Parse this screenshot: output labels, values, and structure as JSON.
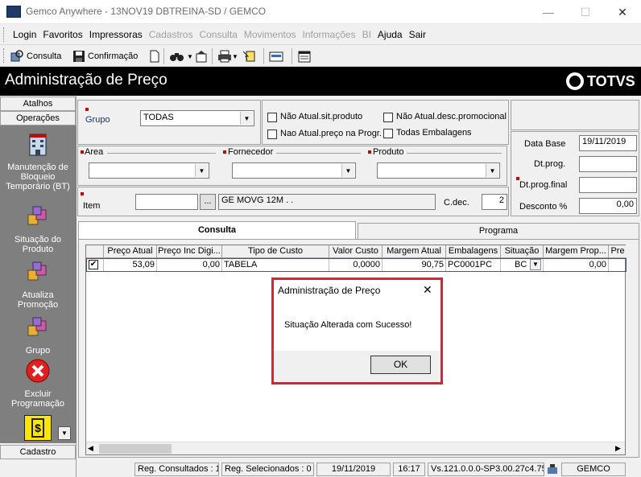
{
  "window": {
    "title": "Gemco Anywhere - 13NOV19 DBTREINA-SD / GEMCO",
    "minimize": "—",
    "maximize": "☐",
    "close": "✕"
  },
  "menu": [
    "Login",
    "Favoritos",
    "Impressoras",
    "Cadastros",
    "Consulta",
    "Movimentos",
    "Informações",
    "BI",
    "Ajuda",
    "Sair"
  ],
  "menu_disabled": [
    false,
    false,
    false,
    true,
    true,
    true,
    true,
    true,
    false,
    false
  ],
  "toolbar": {
    "consulta": "Consulta",
    "confirmacao": "Confirmação"
  },
  "header": {
    "title": "Administração de Preço",
    "logo": "TOTVS"
  },
  "sidebar": {
    "tab_atalhos": "Atalhos",
    "tab_operacoes": "Operações",
    "tab_cadastro": "Cadastro",
    "items": [
      {
        "label": "Manutenção de Bloqueio Temporário (BT)",
        "icon": "building-icon"
      },
      {
        "label": "Situação do Produto",
        "icon": "cubes-icon"
      },
      {
        "label": "Atualiza Promoção",
        "icon": "cubes-icon"
      },
      {
        "label": "Grupo",
        "icon": "cubes-icon"
      },
      {
        "label": "Excluir Programação",
        "icon": "delete-icon"
      }
    ]
  },
  "filters": {
    "grupo_label": "Grupo",
    "grupo_value": "TODAS",
    "chk_nao_atual_sit": "Não Atual.sit.produto",
    "chk_nao_atual_desc": "Não Atual.desc.promocional",
    "chk_nao_atual_preco": "Nao Atual.preço na Progr.",
    "chk_todas_emb": "Todas Embalagens",
    "area_label": "Area",
    "fornecedor_label": "Fornecedor",
    "produto_label": "Produto",
    "item_label": "Item",
    "item_value": "",
    "item_btn": "...",
    "item_desc": "GE MOVG 12M  . .",
    "cdec_label": "C.dec.",
    "cdec_value": "2",
    "data_base_label": "Data Base",
    "data_base_value": "19/11/2019",
    "dt_prog_label": "Dt.prog.",
    "dt_prog_value": "",
    "dt_prog_final_label": "Dt.prog.final",
    "dt_prog_final_value": "",
    "desconto_label": "Desconto %",
    "desconto_value": "0,00"
  },
  "tabs": [
    {
      "label": "Consulta",
      "active": true
    },
    {
      "label": "Programa",
      "active": false
    }
  ],
  "grid": {
    "columns": [
      "Preço Atual",
      "Preço Inc Digi...",
      "Tipo de Custo",
      "Valor Custo",
      "Margem Atual",
      "Embalagens",
      "Situação",
      "Margem Prop...",
      "Pre"
    ],
    "rows": [
      {
        "checked": true,
        "cells": [
          "53,09",
          "0,00",
          "TABELA",
          "0,0000",
          "90,75",
          "PC0001PC",
          "BC",
          "0,00",
          ""
        ]
      }
    ]
  },
  "dialog": {
    "title": "Administração de Preço",
    "message": "Situação Alterada com Sucesso!",
    "ok": "OK",
    "close": "✕"
  },
  "status": {
    "reg_consultados": "Reg. Consultados : 1",
    "reg_selecionados": "Reg. Selecionados : 0",
    "date": "19/11/2019",
    "time": "16:17",
    "version": "Vs.121.0.0.0-SP3.00.27c4.75",
    "company": "GEMCO"
  },
  "colors": {
    "accent_red": "#e3202e",
    "header_bg": "#000000",
    "sidebar_bg": "#7f7f7f"
  }
}
